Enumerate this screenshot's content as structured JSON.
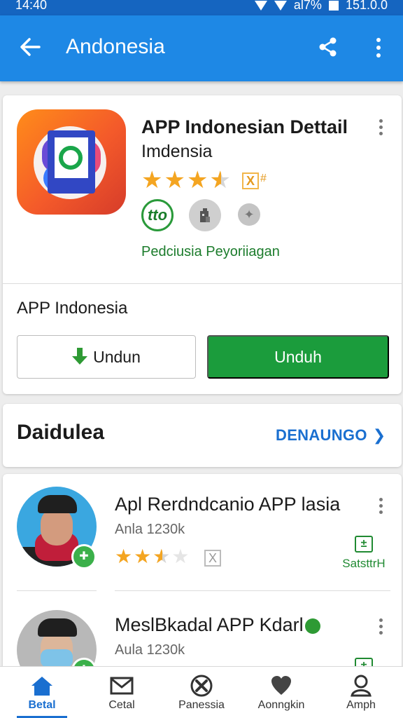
{
  "status_bar": {
    "time": "14:40",
    "battery": "al7%",
    "extra": "151.0.0"
  },
  "app_bar": {
    "title": "Andonesia",
    "back_icon": "arrow-back-icon",
    "share_icon": "share-icon",
    "more_icon": "more-vert-icon"
  },
  "app_card": {
    "title": "APP Indonesian Dettail",
    "subtitle": "Imdensia",
    "rating": 3.5,
    "rating_badge": "X",
    "rating_badge_suffix": "#",
    "chip_labels": [
      "tto",
      "",
      ""
    ],
    "developer": "Pedciusia Peyoriiagan",
    "install_label": "APP Indonesia",
    "secondary_button": "Undun",
    "primary_button": "Unduh",
    "colors": {
      "primary_green": "#1b9c3c",
      "star": "#f4a521",
      "icon_orange": "#f45a2a"
    }
  },
  "section": {
    "title": "Daidulea",
    "link": "DENAUNGO"
  },
  "list": [
    {
      "title": "Apl Rerdndcanio APP lasia",
      "sub": "Anla 1230k",
      "rating": 2.5,
      "action": "SatsttrH",
      "action_icon": "install-box-icon"
    },
    {
      "title": "MeslBkadal APP Kdarl",
      "sub": "Aula 1230k",
      "action_icon": "install-box-icon"
    }
  ],
  "bottom_nav": [
    {
      "label": "Betal",
      "icon": "home-icon",
      "active": true
    },
    {
      "label": "Cetal",
      "icon": "mail-icon",
      "active": false
    },
    {
      "label": "Panessia",
      "icon": "tools-icon",
      "active": false
    },
    {
      "label": "Aonngkin",
      "icon": "heart-icon",
      "active": false
    },
    {
      "label": "Amph",
      "icon": "person-icon",
      "active": false
    }
  ]
}
